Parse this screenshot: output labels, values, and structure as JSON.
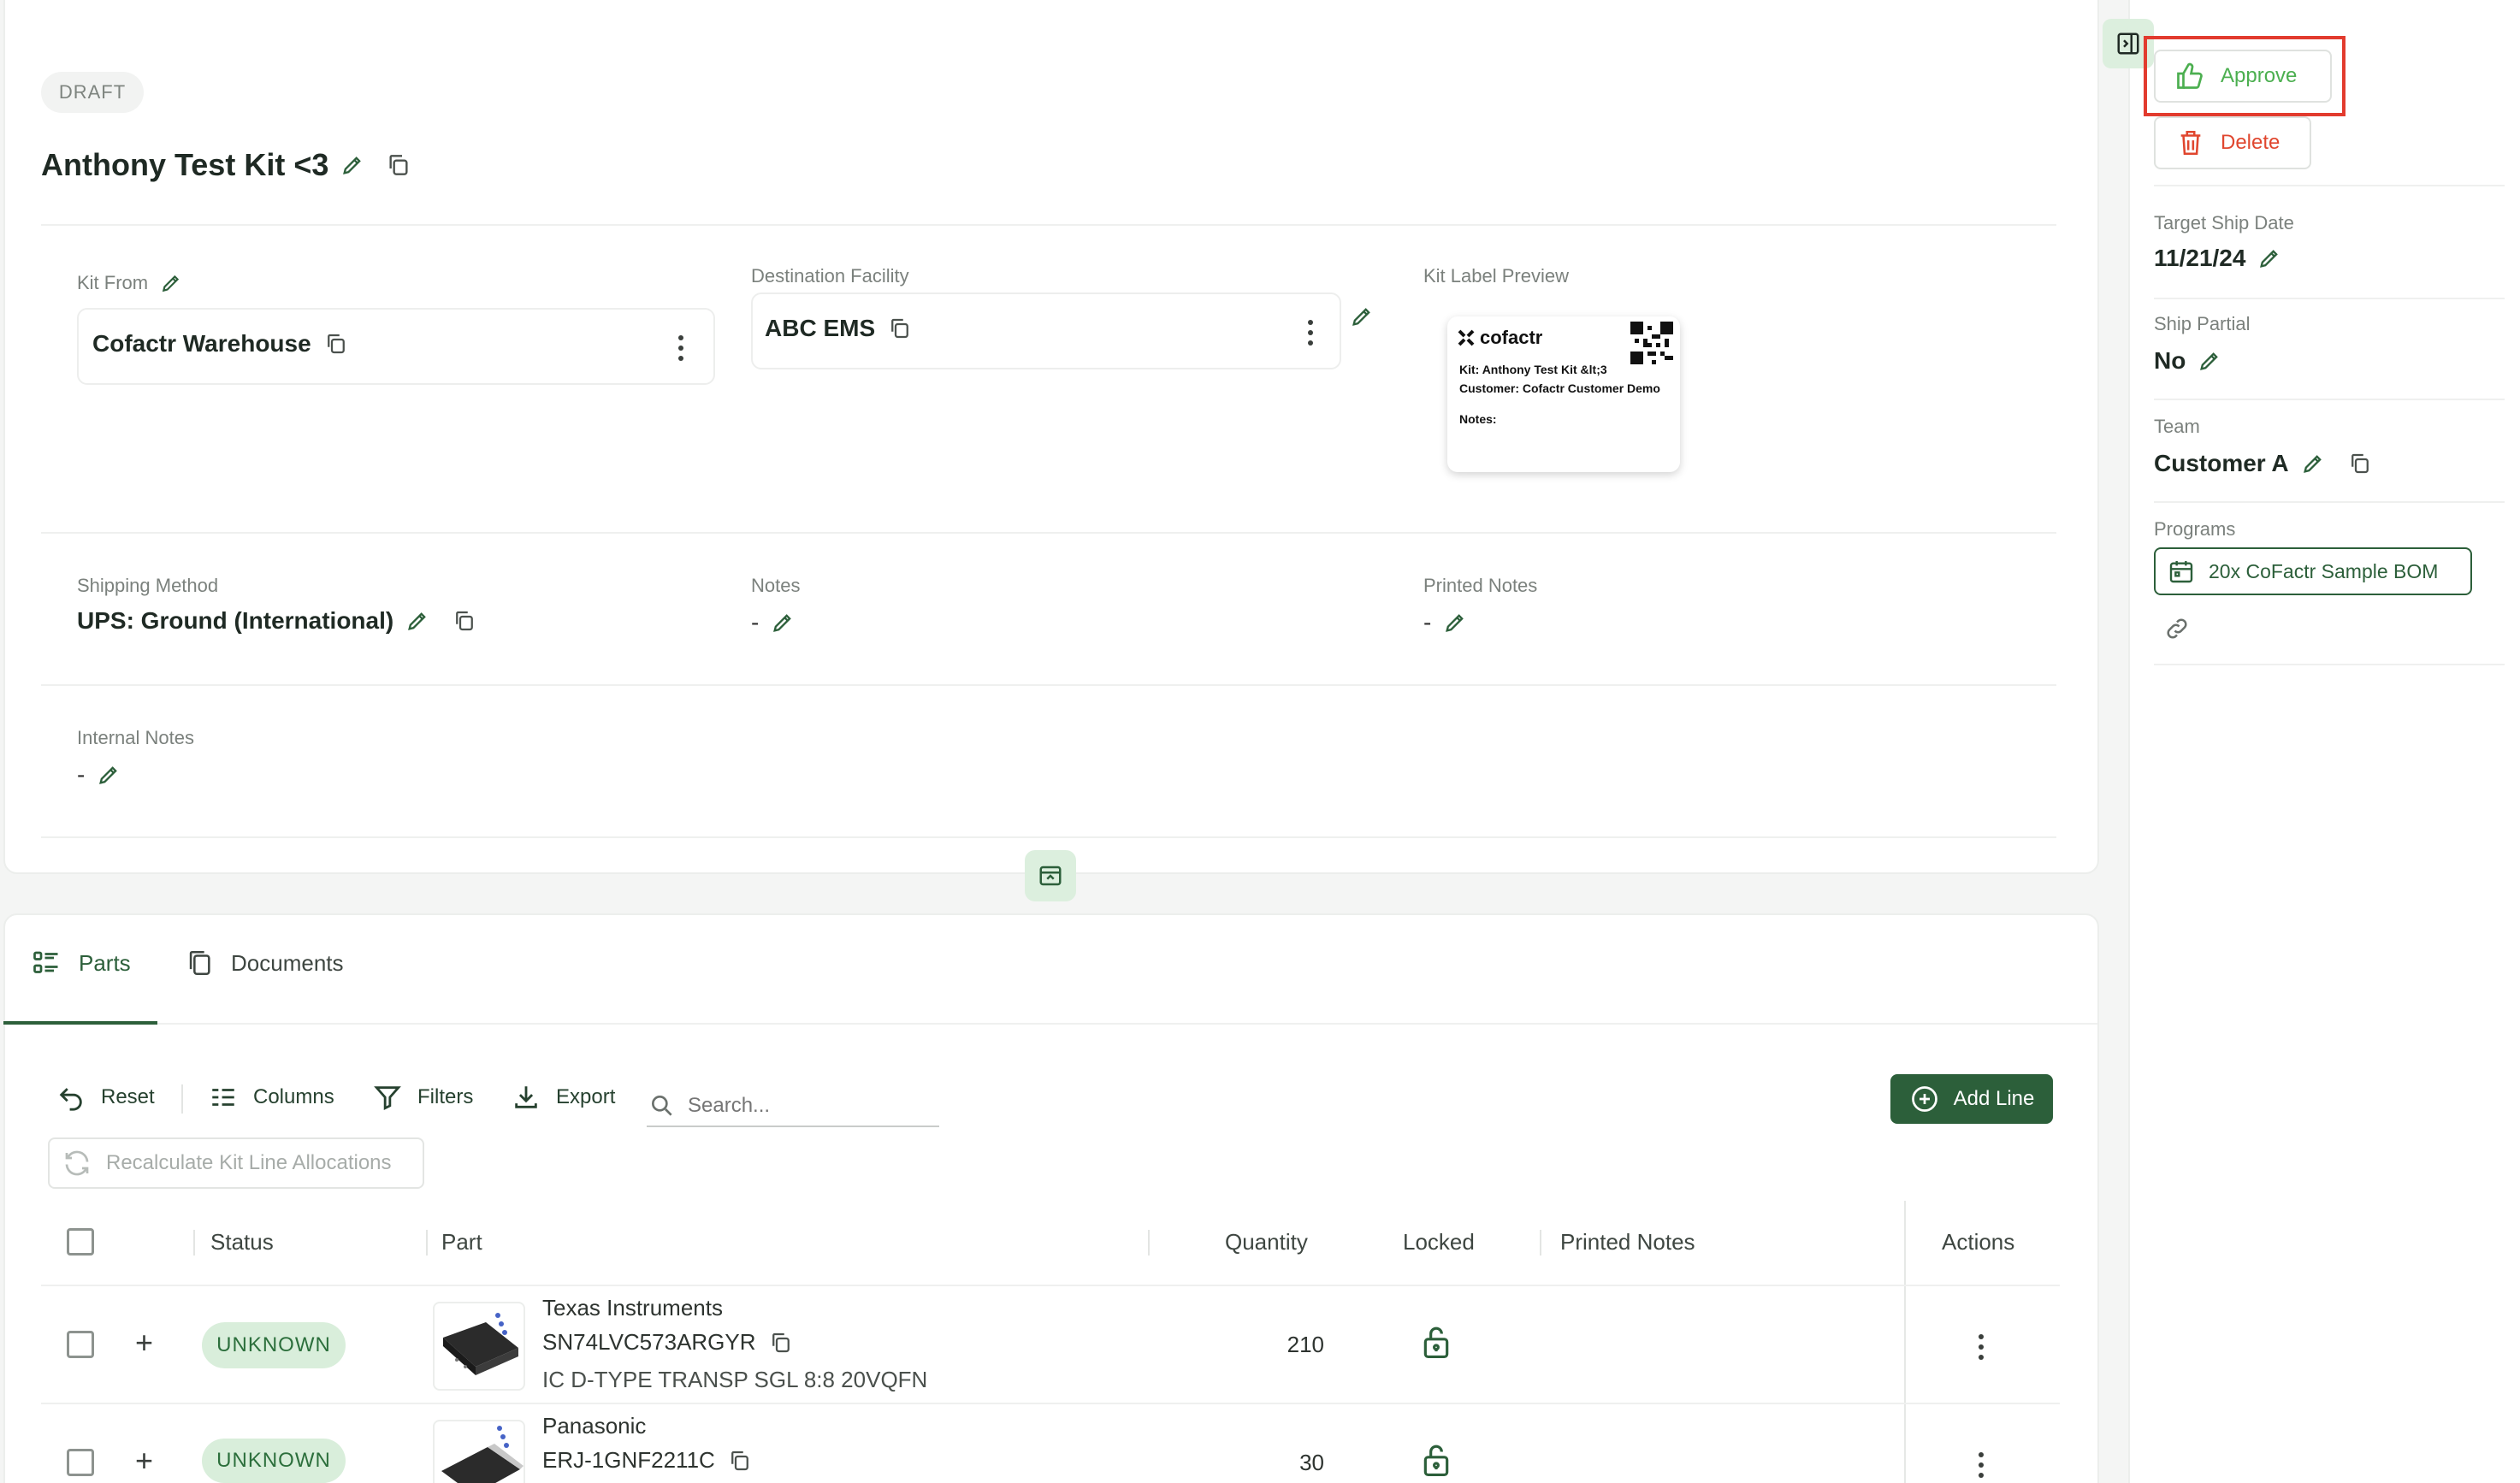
{
  "header": {
    "status_chip": "DRAFT",
    "kit_title": "Anthony Test Kit <3"
  },
  "details": {
    "kit_from_label": "Kit From",
    "kit_from_value": "Cofactr Warehouse",
    "destination_label": "Destination Facility",
    "destination_value": "ABC EMS",
    "label_preview_label": "Kit Label Preview",
    "shipping_method_label": "Shipping Method",
    "shipping_method_value": "UPS: Ground (International)",
    "notes_label": "Notes",
    "notes_value": "-",
    "printed_notes_label": "Printed Notes",
    "printed_notes_value": "-",
    "internal_notes_label": "Internal Notes",
    "internal_notes_value": "-"
  },
  "kit_label": {
    "brand": "cofactr",
    "line1": "Kit: Anthony Test Kit &lt;3",
    "line2": "Customer: Cofactr Customer Demo",
    "line3": "Notes:"
  },
  "sidebar": {
    "approve_label": "Approve",
    "delete_label": "Delete",
    "target_ship_date_label": "Target Ship Date",
    "target_ship_date_value": "11/21/24",
    "ship_partial_label": "Ship Partial",
    "ship_partial_value": "No",
    "team_label": "Team",
    "team_value": "Customer A",
    "programs_label": "Programs",
    "program_chip": "20x CoFactr Sample BOM"
  },
  "tabs": {
    "parts": "Parts",
    "documents": "Documents"
  },
  "toolbar": {
    "reset": "Reset",
    "columns": "Columns",
    "filters": "Filters",
    "export": "Export",
    "search_placeholder": "Search...",
    "add_line": "Add Line",
    "recalculate": "Recalculate Kit Line Allocations"
  },
  "table": {
    "headers": {
      "status": "Status",
      "part": "Part",
      "quantity": "Quantity",
      "locked": "Locked",
      "printed_notes": "Printed Notes",
      "actions": "Actions"
    },
    "rows": [
      {
        "status": "UNKNOWN",
        "manufacturer": "Texas Instruments",
        "mpn": "SN74LVC573ARGYR",
        "description": "IC D-TYPE TRANSP SGL 8:8 20VQFN",
        "quantity": "210"
      },
      {
        "status": "UNKNOWN",
        "manufacturer": "Panasonic",
        "mpn": "ERJ-1GNF2211C",
        "description": "",
        "quantity": "30"
      }
    ]
  },
  "colors": {
    "accent_green": "#2c5f3a",
    "approve_green": "#4caf50",
    "delete_red": "#e0462e",
    "highlight_red": "#e23b2e",
    "status_bg": "#d9eedb"
  }
}
